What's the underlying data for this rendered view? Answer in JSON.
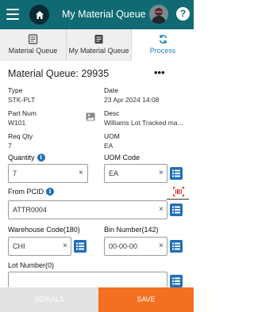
{
  "appbar": {
    "title": "My Material Queue",
    "menu_icon": "menu-icon",
    "home_icon": "home-icon",
    "help_label": "?",
    "colors": {
      "appbar": "#0f6a74",
      "home_circle": "#0c2a33"
    }
  },
  "tabs": [
    {
      "label": "Material Queue",
      "icon": "document-outline-icon"
    },
    {
      "label": "My Material Queue",
      "icon": "document-filled-icon"
    },
    {
      "label": "Process",
      "icon": "sync-icon",
      "active": true
    }
  ],
  "header": {
    "title": "Material Queue: 29935",
    "more": "•••"
  },
  "details": {
    "type_label": "Type",
    "type_value": "STK-PLT",
    "date_label": "Date",
    "date_value": "23 Apr 2024 14:08",
    "part_label": "Part Num",
    "part_value": "W101",
    "desc_label": "Desc",
    "desc_value": "Williams Lot Tracked ma...",
    "req_label": "Req Qty",
    "req_value": "7",
    "uom_label": "UOM",
    "uom_value": "EA"
  },
  "form": {
    "quantity_label": "Quantity",
    "quantity_value": "7",
    "uom_code_label": "UOM Code",
    "uom_code_value": "EA",
    "from_pcid_label": "From PCID",
    "from_pcid_value": "ATTR0004",
    "warehouse_label": "Warehouse Code(180)",
    "warehouse_value": "CHI",
    "bin_label": "Bin Number(142)",
    "bin_value": "00-00-00",
    "lot_label": "Lot Number(0)",
    "lot_value": "",
    "clear_glyph": "×",
    "info_glyph": "i"
  },
  "actions": {
    "serials_label": "SERIALS",
    "save_label": "SAVE"
  },
  "colors": {
    "accent_blue": "#1f6fb8",
    "save_orange": "#f36f21",
    "scan_red": "#d9342b",
    "disabled_gray": "#e2e2e2"
  }
}
